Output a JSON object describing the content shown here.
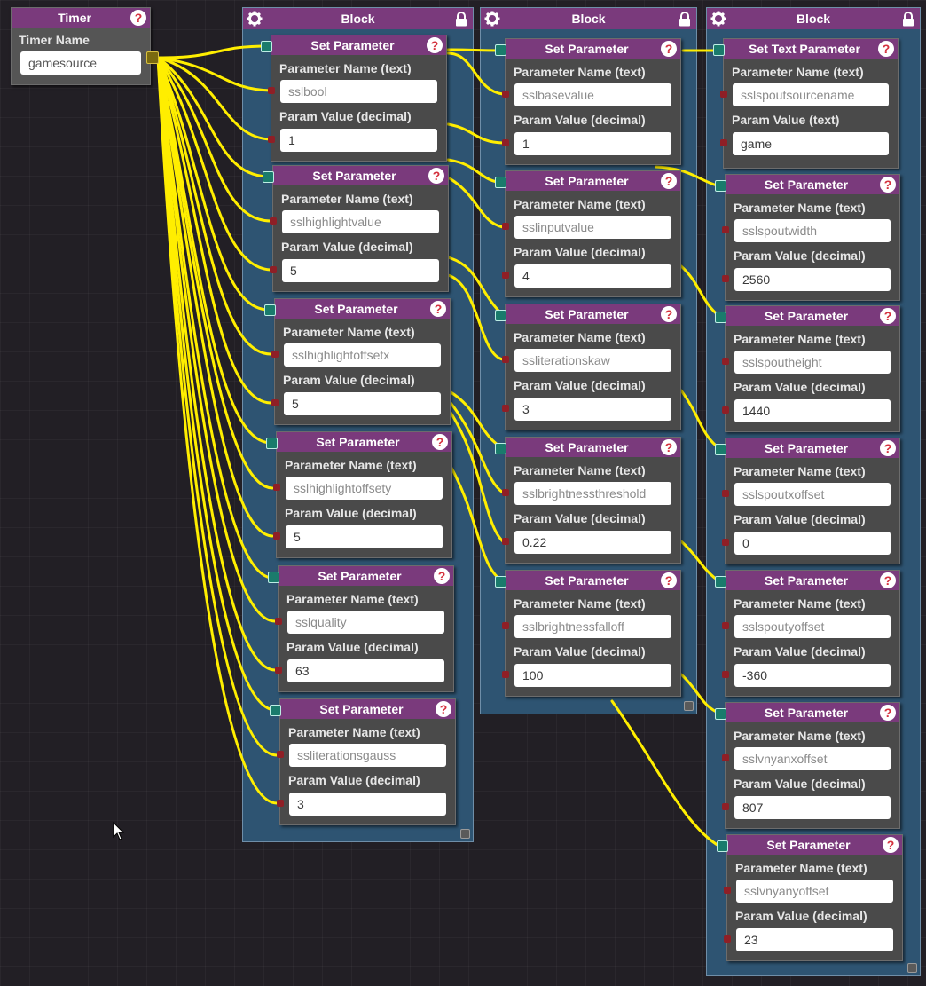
{
  "timer": {
    "title": "Timer",
    "name_label": "Timer Name",
    "name_value": "gamesource"
  },
  "blocks": [
    {
      "title": "Block"
    },
    {
      "title": "Block"
    },
    {
      "title": "Block"
    }
  ],
  "nodes": [
    {
      "title": "Set Parameter",
      "label1": "Parameter Name (text)",
      "value1": "sslbool",
      "label2": "Param Value (decimal)",
      "value2": "1"
    },
    {
      "title": "Set Parameter",
      "label1": "Parameter Name (text)",
      "value1": "sslhighlightvalue",
      "label2": "Param Value (decimal)",
      "value2": "5"
    },
    {
      "title": "Set Parameter",
      "label1": "Parameter Name (text)",
      "value1": "sslhighlightoffsetx",
      "label2": "Param Value (decimal)",
      "value2": "5"
    },
    {
      "title": "Set Parameter",
      "label1": "Parameter Name (text)",
      "value1": "sslhighlightoffsety",
      "label2": "Param Value (decimal)",
      "value2": "5"
    },
    {
      "title": "Set Parameter",
      "label1": "Parameter Name (text)",
      "value1": "sslquality",
      "label2": "Param Value (decimal)",
      "value2": "63"
    },
    {
      "title": "Set Parameter",
      "label1": "Parameter Name (text)",
      "value1": "ssliterationsgauss",
      "label2": "Param Value (decimal)",
      "value2": "3"
    },
    {
      "title": "Set Parameter",
      "label1": "Parameter Name (text)",
      "value1": "sslbasevalue",
      "label2": "Param Value (decimal)",
      "value2": "1"
    },
    {
      "title": "Set Parameter",
      "label1": "Parameter Name (text)",
      "value1": "sslinputvalue",
      "label2": "Param Value (decimal)",
      "value2": "4"
    },
    {
      "title": "Set Parameter",
      "label1": "Parameter Name (text)",
      "value1": "ssliterationskaw",
      "label2": "Param Value (decimal)",
      "value2": "3"
    },
    {
      "title": "Set Parameter",
      "label1": "Parameter Name (text)",
      "value1": "sslbrightnessthreshold",
      "label2": "Param Value (decimal)",
      "value2": "0.22"
    },
    {
      "title": "Set Parameter",
      "label1": "Parameter Name (text)",
      "value1": "sslbrightnessfalloff",
      "label2": "Param Value (decimal)",
      "value2": "100"
    },
    {
      "title": "Set Text Parameter",
      "label1": "Parameter Name (text)",
      "value1": "sslspoutsourcename",
      "label2": "Param Value (text)",
      "value2": "game"
    },
    {
      "title": "Set Parameter",
      "label1": "Parameter Name (text)",
      "value1": "sslspoutwidth",
      "label2": "Param Value (decimal)",
      "value2": "2560"
    },
    {
      "title": "Set Parameter",
      "label1": "Parameter Name (text)",
      "value1": "sslspoutheight",
      "label2": "Param Value (decimal)",
      "value2": "1440"
    },
    {
      "title": "Set Parameter",
      "label1": "Parameter Name (text)",
      "value1": "sslspoutxoffset",
      "label2": "Param Value (decimal)",
      "value2": "0"
    },
    {
      "title": "Set Parameter",
      "label1": "Parameter Name (text)",
      "value1": "sslspoutyoffset",
      "label2": "Param Value (decimal)",
      "value2": "-360"
    },
    {
      "title": "Set Parameter",
      "label1": "Parameter Name (text)",
      "value1": "sslvnyanxoffset",
      "label2": "Param Value (decimal)",
      "value2": "807"
    },
    {
      "title": "Set Parameter",
      "label1": "Parameter Name (text)",
      "value1": "sslvnyanyoffset",
      "label2": "Param Value (decimal)",
      "value2": "23"
    }
  ],
  "icons": {
    "help": "?",
    "gear": "gear-icon",
    "lock": "lock-icon",
    "cursor": "mouse-pointer-icon"
  },
  "colors": {
    "background": "#221f25",
    "header": "#7a3a7c",
    "block": "#2e5472",
    "node": "#4a4a4a",
    "wire": "#ffee00",
    "input_port": "#1a7b6c",
    "pin": "#8f1f26"
  }
}
